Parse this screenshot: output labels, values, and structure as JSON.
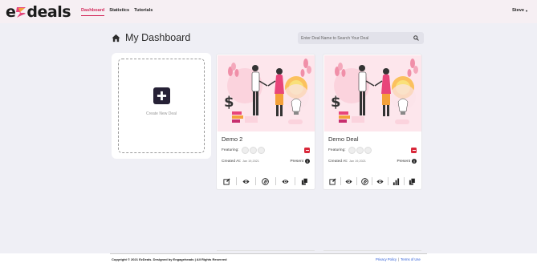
{
  "brand": {
    "logo_left": "e",
    "logo_right": "deals"
  },
  "nav": {
    "items": [
      {
        "label": "Dashboard",
        "active": true
      },
      {
        "label": "Statistics",
        "active": false
      },
      {
        "label": "Tutorials",
        "active": false
      }
    ],
    "user_name": "Steve",
    "user_caret": "▾"
  },
  "header": {
    "title": "My Dashboard",
    "search_placeholder": "Enter Deal Name to Search Your Deal"
  },
  "create_card": {
    "label": "Create New Deal"
  },
  "deals": [
    {
      "name": "Demo 2",
      "featuring_label": "Featuring:",
      "created_label": "Created At:",
      "created_date": "Jan 19,2021",
      "status": "Present",
      "actions": [
        "edit-icon",
        "eye-icon",
        "stats-icon",
        "eye-icon",
        "copy-icon"
      ]
    },
    {
      "name": "Demo Deal",
      "featuring_label": "Featuring:",
      "created_label": "Created At:",
      "created_date": "Jan 19,2021",
      "status": "Present",
      "actions": [
        "edit-icon",
        "eye-icon",
        "stats-icon",
        "eye-icon",
        "bar-chart-icon",
        "copy-icon"
      ]
    }
  ],
  "footer": {
    "copyright": "Copyright © 2021 EzDeals. Designed by Engageheads | All Rights Reserved",
    "privacy": "Privacy Policy",
    "separator": "|",
    "terms": "Terms of Use"
  },
  "colors": {
    "accent": "#d3285a",
    "dark": "#262136",
    "danger": "#d9283a",
    "link": "#2b5bd7"
  }
}
